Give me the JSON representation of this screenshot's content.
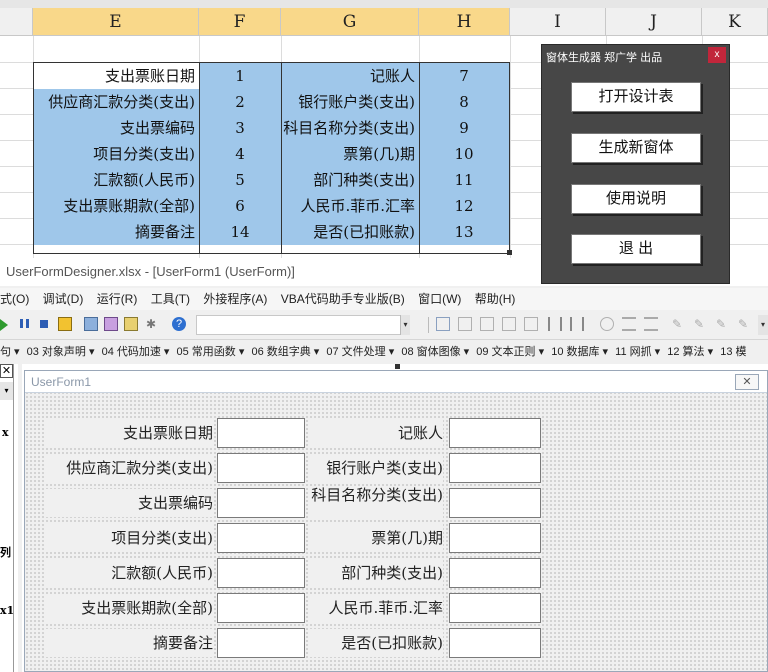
{
  "excel": {
    "columns": [
      "E",
      "F",
      "G",
      "H",
      "I",
      "J",
      "K"
    ],
    "rows": [
      {
        "label1": "支出票账日期",
        "num1": "1",
        "label2": "记账人",
        "num2": "7"
      },
      {
        "label1": "供应商汇款分类(支出)",
        "num1": "2",
        "label2": "银行账户类(支出)",
        "num2": "8"
      },
      {
        "label1": "支出票编码",
        "num1": "3",
        "label2": "科目名称分类(支出)",
        "num2": "9"
      },
      {
        "label1": "项目分类(支出)",
        "num1": "4",
        "label2": "票第(几)期",
        "num2": "10"
      },
      {
        "label1": "汇款额(人民币)",
        "num1": "5",
        "label2": "部门种类(支出)",
        "num2": "11"
      },
      {
        "label1": "支出票账期款(全部)",
        "num1": "6",
        "label2": "人民币.菲币.汇率",
        "num2": "12"
      },
      {
        "label1": "摘要备注",
        "num1": "14",
        "label2": "是否(已扣账款)",
        "num2": "13"
      }
    ]
  },
  "panel": {
    "title": "窗体生成器 郑广学 出品",
    "close": "x",
    "buttons": [
      "打开设计表",
      "生成新窗体",
      "使用说明",
      "退 出"
    ]
  },
  "vba": {
    "title": "UserFormDesigner.xlsx - [UserForm1 (UserForm)]",
    "menu": [
      "式(O)",
      "调试(D)",
      "运行(R)",
      "工具(T)",
      "外接程序(A)",
      "VBA代码助手专业版(B)",
      "窗口(W)",
      "帮助(H)"
    ],
    "nav": [
      "句 ▾",
      "03 对象声明 ▾",
      "04 代码加速 ▾",
      "05 常用函数 ▾",
      "06 数组字典 ▾",
      "07 文件处理 ▾",
      "08 窗体图像 ▾",
      "09 文本正则 ▾",
      "10 数据库 ▾",
      "11 网抓 ▾",
      "12 算法 ▾",
      "13 模"
    ],
    "left_pane_chars": [
      "x",
      "列",
      "x1"
    ],
    "form": {
      "title": "UserForm1",
      "close": "✕",
      "left_labels": [
        "支出票账日期",
        "供应商汇款分类(支出)",
        "支出票编码",
        "项目分类(支出)",
        "汇款额(人民币)",
        "支出票账期款(全部)",
        "摘要备注"
      ],
      "right_labels": [
        "记账人",
        "银行账户类(支出)",
        "科目名称分类(支出)",
        "票第(几)期",
        "部门种类(支出)",
        "人民币.菲币.汇率",
        "是否(已扣账款)"
      ]
    }
  },
  "colors": {
    "selection_blue": "#9fc7ea",
    "panel_bg": "#474747",
    "close_red": "#c1263b",
    "header_highlight": "#f9d88a"
  }
}
